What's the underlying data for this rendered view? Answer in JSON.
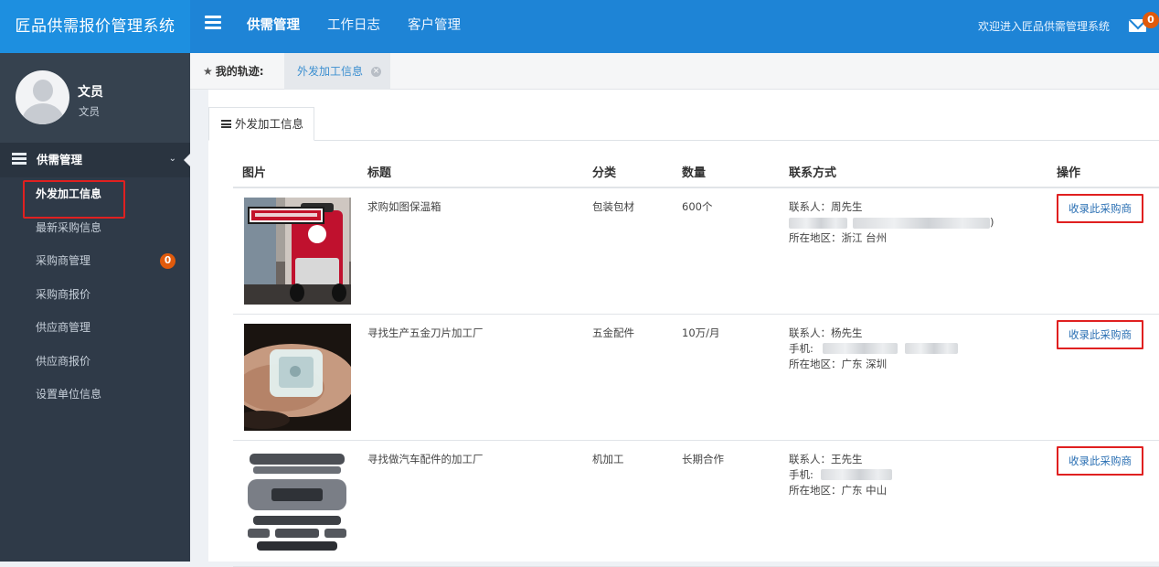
{
  "app": {
    "title": "匠品供需报价管理系统"
  },
  "topnav": {
    "items": [
      {
        "label": "供需管理",
        "active": true
      },
      {
        "label": "工作日志",
        "active": false
      },
      {
        "label": "客户管理",
        "active": false
      }
    ],
    "welcome": "欢迎进入匠品供需管理系统",
    "mail_count": "0"
  },
  "user": {
    "name": "文员",
    "role": "文员"
  },
  "sidebar": {
    "group_label": "供需管理",
    "items": [
      {
        "label": "外发加工信息",
        "active": true,
        "badge": ""
      },
      {
        "label": "最新采购信息",
        "active": false,
        "badge": ""
      },
      {
        "label": "采购商管理",
        "active": false,
        "badge": "0"
      },
      {
        "label": "采购商报价",
        "active": false,
        "badge": ""
      },
      {
        "label": "供应商管理",
        "active": false,
        "badge": ""
      },
      {
        "label": "供应商报价",
        "active": false,
        "badge": ""
      },
      {
        "label": "设置单位信息",
        "active": false,
        "badge": ""
      }
    ]
  },
  "breadcrumb": {
    "title": "我的轨迹:",
    "tab": "外发加工信息"
  },
  "panel": {
    "tab_label": "外发加工信息"
  },
  "table": {
    "headers": [
      "图片",
      "标题",
      "分类",
      "数量",
      "联系方式",
      "操作"
    ],
    "rows": [
      {
        "image": "red-cooler-bag",
        "title": "求购如图保温箱",
        "category": "包装包材",
        "quantity": "600个",
        "contact_name": "联系人：周先生",
        "phone_prefix": "",
        "region": "所在地区：浙江 台州",
        "action": "收录此采购商"
      },
      {
        "image": "metal-blade-in-hand",
        "title": "寻找生产五金刀片加工厂",
        "category": "五金配件",
        "quantity": "10万/月",
        "contact_name": "联系人：杨先生",
        "phone_prefix": "手机:",
        "region": "所在地区：广东 深圳",
        "action": "收录此采购商"
      },
      {
        "image": "car-bumper-parts",
        "title": "寻找做汽车配件的加工厂",
        "category": "机加工",
        "quantity": "长期合作",
        "contact_name": "联系人：王先生",
        "phone_prefix": "手机:",
        "region": "所在地区：广东 中山",
        "action": "收录此采购商"
      }
    ]
  },
  "colors": {
    "brand_blue": "#1d8fe0",
    "topbar_blue": "#1e84d6",
    "sidebar_bg": "#2f3a48",
    "badge_orange": "#e05a0c",
    "highlight_red": "#e02020",
    "link_blue": "#2a6fb3"
  }
}
